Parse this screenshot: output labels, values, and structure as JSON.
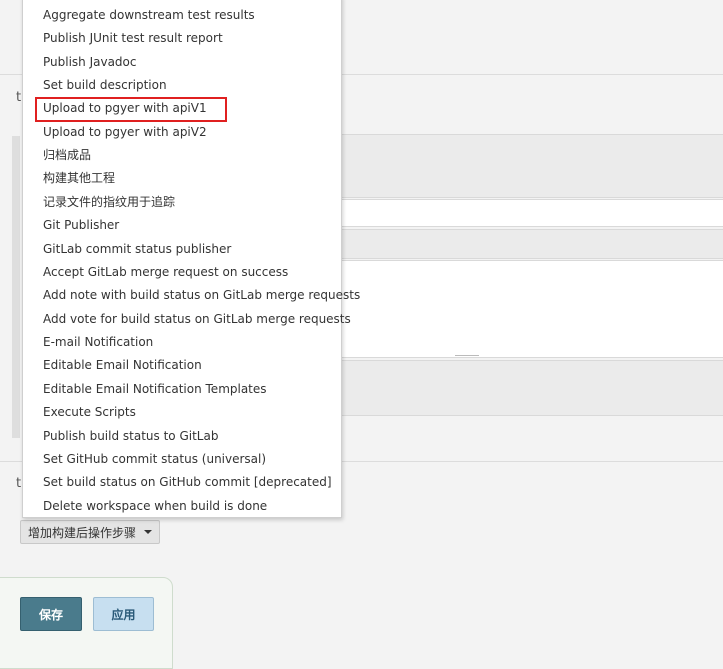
{
  "menu": {
    "items": [
      "Aggregate downstream test results",
      "Publish JUnit test result report",
      "Publish Javadoc",
      "Set build description",
      "Upload to pgyer with apiV1",
      "Upload to pgyer with apiV2",
      "归档成品",
      "构建其他工程",
      "记录文件的指纹用于追踪",
      "Git Publisher",
      "GitLab commit status publisher",
      "Accept GitLab merge request on success",
      "Add note with build status on GitLab merge requests",
      "Add vote for build status on GitLab merge requests",
      "E-mail Notification",
      "Editable Email Notification",
      "Editable Email Notification Templates",
      "Execute Scripts",
      "Publish build status to GitLab",
      "Set GitHub commit status (universal)",
      "Set build status on GitHub commit [deprecated]",
      "Delete workspace when build is done"
    ],
    "highlighted_item": "Upload to pgyer with apiV1",
    "highlight_color": "#e02020"
  },
  "post_build": {
    "add_step_label": "增加构建后操作步骤"
  },
  "footer": {
    "save_label": "保存",
    "apply_label": "应用"
  },
  "colors": {
    "save_bg": "#4a7b8c",
    "apply_bg": "#c7dff0"
  }
}
